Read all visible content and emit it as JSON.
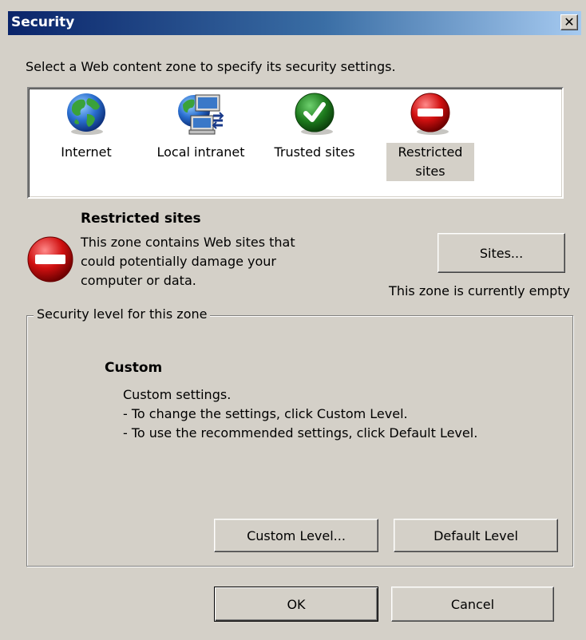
{
  "window": {
    "title": "Security",
    "close_label": "✕"
  },
  "instruction": "Select a Web content zone to specify its security settings.",
  "zones": [
    {
      "label": "Internet",
      "icon": "globe-icon",
      "selected": false
    },
    {
      "label": "Local intranet",
      "icon": "network-computer-icon",
      "selected": false
    },
    {
      "label": "Trusted sites",
      "icon": "checkmark-icon",
      "selected": false
    },
    {
      "label": "Restricted sites",
      "label_line1": "Restricted",
      "label_line2": "sites",
      "icon": "no-entry-icon",
      "selected": true
    }
  ],
  "selected_zone": {
    "title": "Restricted sites",
    "description_lines": [
      "This zone contains Web sites that",
      "could potentially damage your",
      "computer or data."
    ],
    "icon": "no-entry-icon",
    "sites_button": "Sites...",
    "status": "This zone is currently empty"
  },
  "security_level": {
    "group_label": "Security level for this zone",
    "level_name": "Custom",
    "lines": [
      "Custom settings.",
      "- To change the settings, click Custom Level.",
      "- To use the recommended settings, click Default Level."
    ],
    "custom_button": "Custom Level...",
    "default_button": "Default Level"
  },
  "footer": {
    "ok_label": "OK",
    "cancel_label": "Cancel"
  },
  "colors": {
    "dialog_bg": "#d4d0c8",
    "titlebar_start": "#0a246a",
    "titlebar_end": "#a6caf0",
    "restricted_red": "#d01010",
    "trusted_green": "#1d7a1d"
  }
}
